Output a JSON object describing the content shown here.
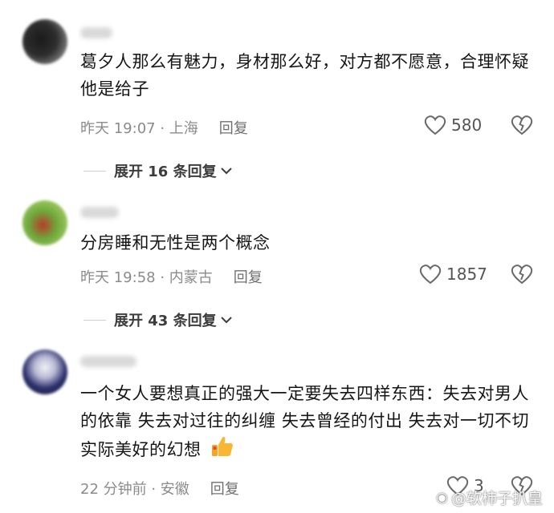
{
  "comments": [
    {
      "text": "葛夕人那么有魅力，身材那么好，对方都不愿意，合理怀疑他是给子",
      "time_location": "昨天 19:07 · 上海",
      "reply_label": "回复",
      "likes": "580",
      "expand_label": "展开 16 条回复"
    },
    {
      "text": "分房睡和无性是两个概念",
      "time_location": "昨天 19:58 · 内蒙古",
      "reply_label": "回复",
      "likes": "1857",
      "expand_label": "展开 43 条回复"
    },
    {
      "text": "一个女人要想真正的强大一定要失去四样东西：失去对男人的依靠 失去对过往的纠缠 失去曾经的付出 失去对一切不切实际美好的幻想",
      "time_location": "22 分钟前 · 安徽",
      "reply_label": "回复",
      "likes": "3",
      "emoji": "thumbs-up-emoji"
    }
  ],
  "watermark": {
    "text": "@软柿子扒皇"
  },
  "icons": {
    "like": "heart-outline-icon",
    "dislike": "broken-heart-icon",
    "expand": "chevron-down-icon"
  },
  "colors": {
    "meta": "#8b8b8b",
    "text": "#161616"
  }
}
